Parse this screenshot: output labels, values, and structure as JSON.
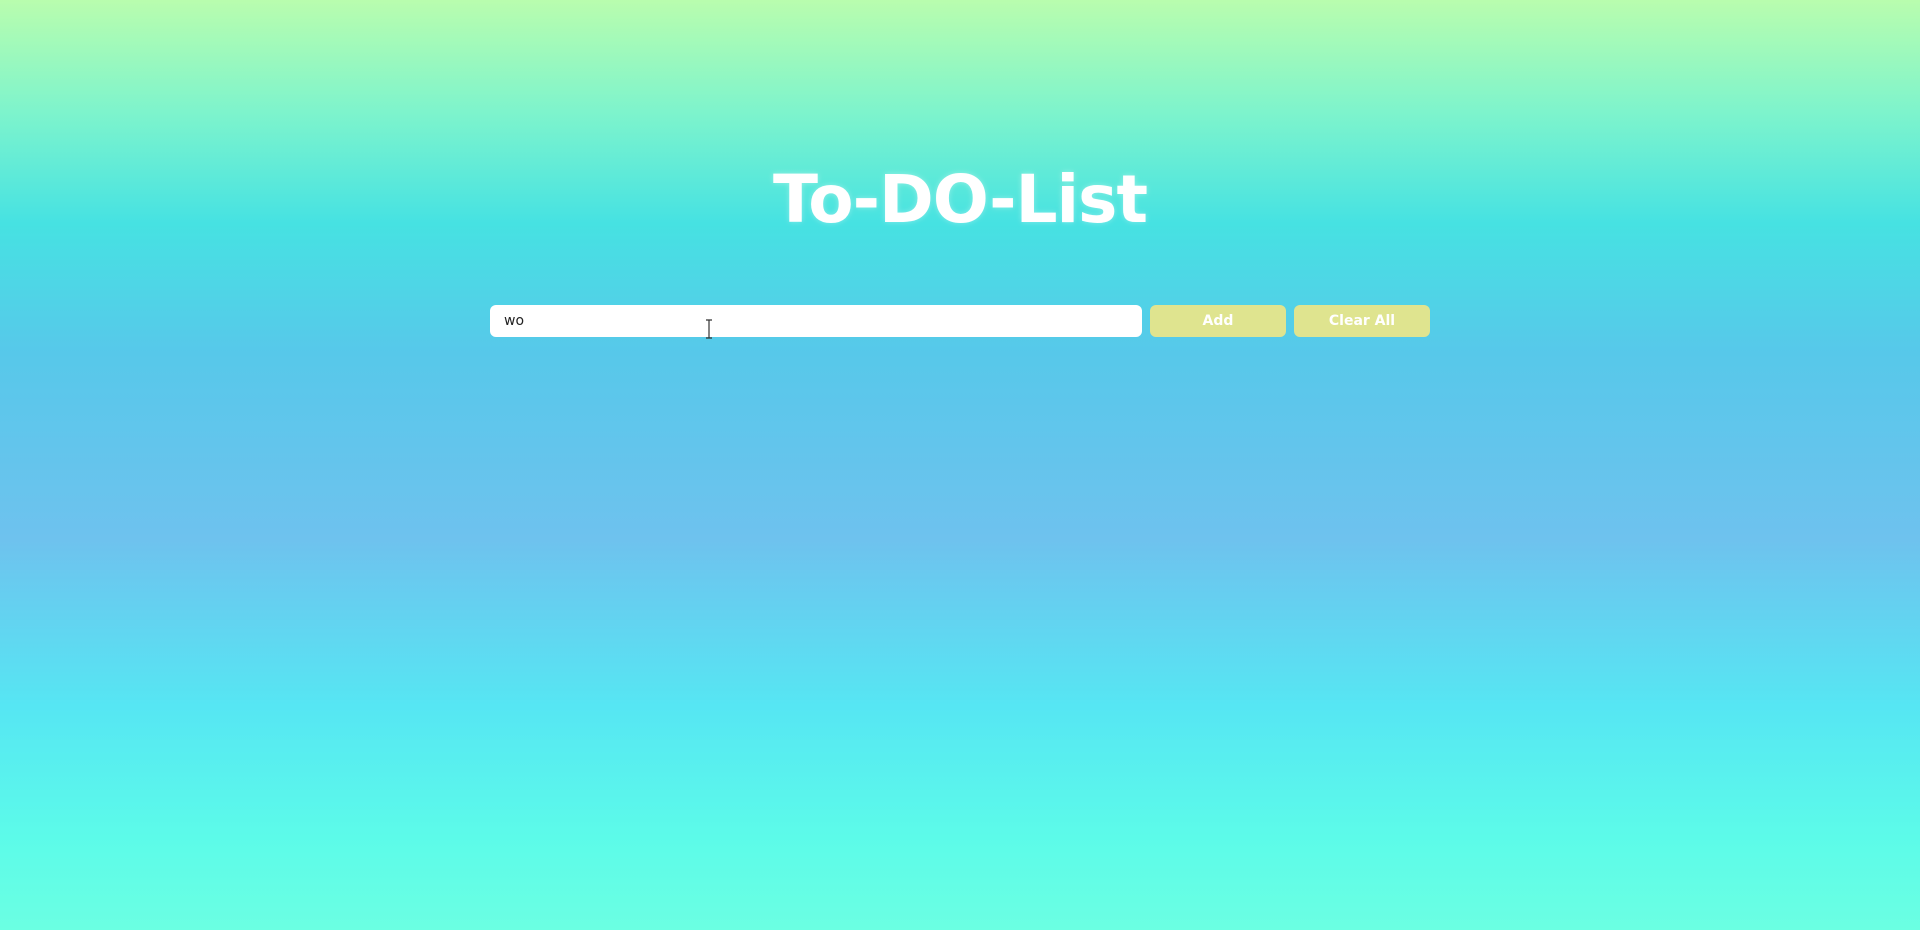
{
  "app": {
    "title": "To-DO-List"
  },
  "form": {
    "input_value": "wo",
    "input_placeholder": "",
    "add_label": "Add",
    "clear_label": "Clear All"
  },
  "colors": {
    "button_bg": "#dfe48f",
    "title_color": "#ffffff"
  },
  "icons": {
    "text_cursor": "i-beam-cursor-icon"
  },
  "tasks": []
}
